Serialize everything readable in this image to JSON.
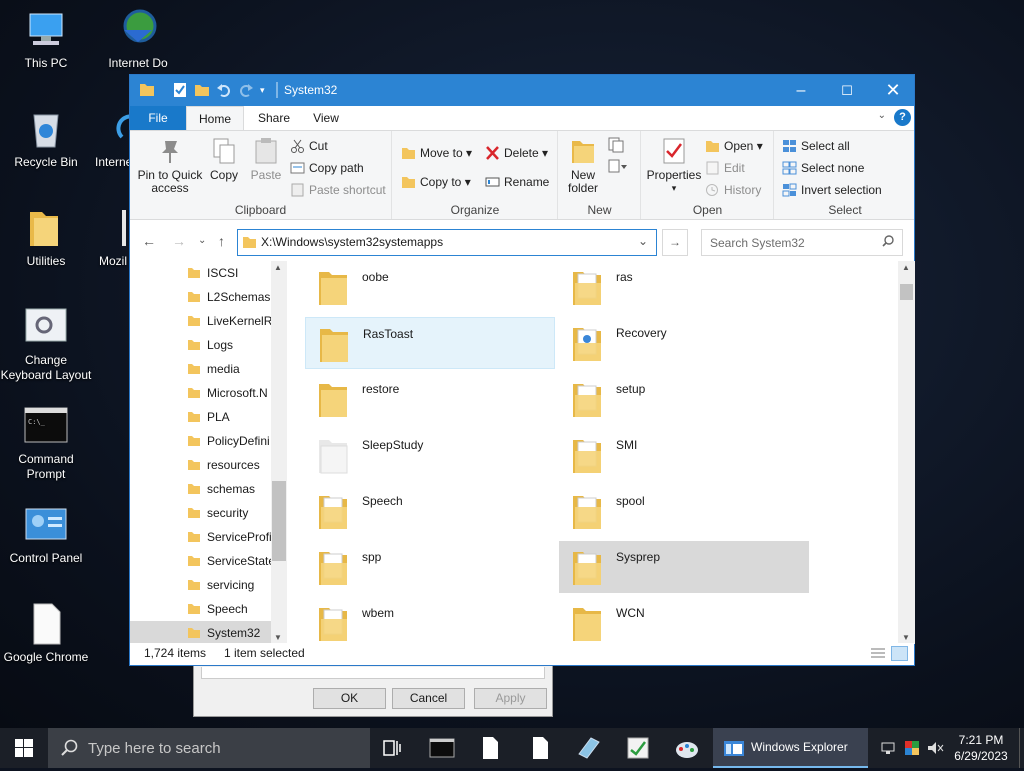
{
  "desktop": {
    "icons": [
      {
        "label": "This PC"
      },
      {
        "label": "Recycle Bin"
      },
      {
        "label": "Utilities"
      },
      {
        "label": "Change Keyboard Layout"
      },
      {
        "label": "Command Prompt"
      },
      {
        "label": "Control Panel"
      },
      {
        "label": "Google Chrome"
      },
      {
        "label": "Internet Do"
      },
      {
        "label": "Interne"
      },
      {
        "label": "Mozil"
      }
    ]
  },
  "background_dialog": {
    "ok": "OK",
    "cancel": "Cancel",
    "apply": "Apply"
  },
  "explorer": {
    "title": "System32",
    "tabs": {
      "file": "File",
      "home": "Home",
      "share": "Share",
      "view": "View"
    },
    "ribbon": {
      "clipboard": {
        "label": "Clipboard",
        "pin_line1": "Pin to Quick",
        "pin_line2": "access",
        "copy": "Copy",
        "paste": "Paste",
        "cut": "Cut",
        "copy_path": "Copy path",
        "paste_shortcut": "Paste shortcut"
      },
      "organize": {
        "label": "Organize",
        "move_to": "Move to",
        "copy_to": "Copy to",
        "delete": "Delete",
        "rename": "Rename"
      },
      "new": {
        "label": "New",
        "new_folder_line1": "New",
        "new_folder_line2": "folder"
      },
      "open": {
        "label": "Open",
        "properties": "Properties",
        "open": "Open",
        "edit": "Edit",
        "history": "History"
      },
      "select": {
        "label": "Select",
        "select_all": "Select all",
        "select_none": "Select none",
        "invert": "Invert selection"
      }
    },
    "address": "X:\\Windows\\system32systemapps",
    "search_placeholder": "Search System32",
    "tree": [
      "ISCSI",
      "L2Schemas",
      "LiveKernelR",
      "Logs",
      "media",
      "Microsoft.N",
      "PLA",
      "PolicyDefini",
      "resources",
      "schemas",
      "security",
      "ServiceProfi",
      "ServiceState",
      "servicing",
      "Speech",
      "System32"
    ],
    "items": [
      {
        "name": "oobe"
      },
      {
        "name": "ras"
      },
      {
        "name": "RasToast"
      },
      {
        "name": "Recovery"
      },
      {
        "name": "restore"
      },
      {
        "name": "setup"
      },
      {
        "name": "SleepStudy"
      },
      {
        "name": "SMI"
      },
      {
        "name": "Speech"
      },
      {
        "name": "spool"
      },
      {
        "name": "spp"
      },
      {
        "name": "Sysprep"
      },
      {
        "name": "wbem"
      },
      {
        "name": "WCN"
      }
    ],
    "status": {
      "count": "1,724 items",
      "selected": "1 item selected"
    }
  },
  "taskbar": {
    "search_placeholder": "Type here to search",
    "active_app": "Windows Explorer",
    "time": "7:21 PM",
    "date": "6/29/2023"
  },
  "colors": {
    "titlebar": "#2c84d3",
    "accent": "#1979ca",
    "folder": "#f3c55d"
  }
}
